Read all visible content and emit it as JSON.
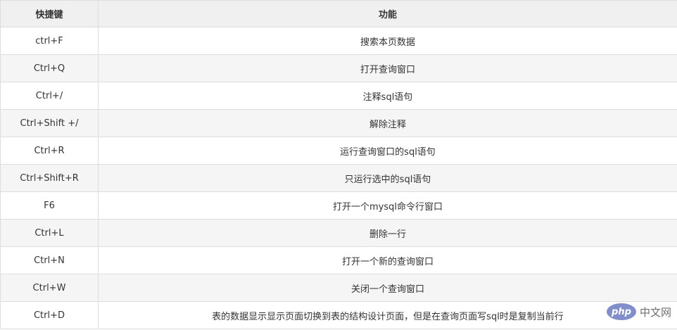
{
  "table": {
    "headers": {
      "key": "快捷键",
      "function": "功能"
    },
    "rows": [
      {
        "key": "ctrl+F",
        "function": "搜索本页数据"
      },
      {
        "key": "Ctrl+Q",
        "function": "打开查询窗口"
      },
      {
        "key": "Ctrl+/",
        "function": "注释sql语句"
      },
      {
        "key": "Ctrl+Shift +/",
        "function": "解除注释"
      },
      {
        "key": "Ctrl+R",
        "function": "运行查询窗口的sql语句"
      },
      {
        "key": "Ctrl+Shift+R",
        "function": "只运行选中的sql语句"
      },
      {
        "key": "F6",
        "function": "打开一个mysql命令行窗口"
      },
      {
        "key": "Ctrl+L",
        "function": "删除一行"
      },
      {
        "key": "Ctrl+N",
        "function": "打开一个新的查询窗口"
      },
      {
        "key": "Ctrl+W",
        "function": "关闭一个查询窗口"
      },
      {
        "key": "Ctrl+D",
        "function": "表的数据显示显示页面切换到表的结构设计页面，但是在查询页面写sql时是复制当前行"
      }
    ]
  },
  "watermark": {
    "logo_text": "php",
    "site_text": "中文网"
  },
  "colors": {
    "header_bg": "#f0f0f0",
    "stripe_bg": "#f5f5f5",
    "border": "#dddddd",
    "text": "#333333"
  }
}
